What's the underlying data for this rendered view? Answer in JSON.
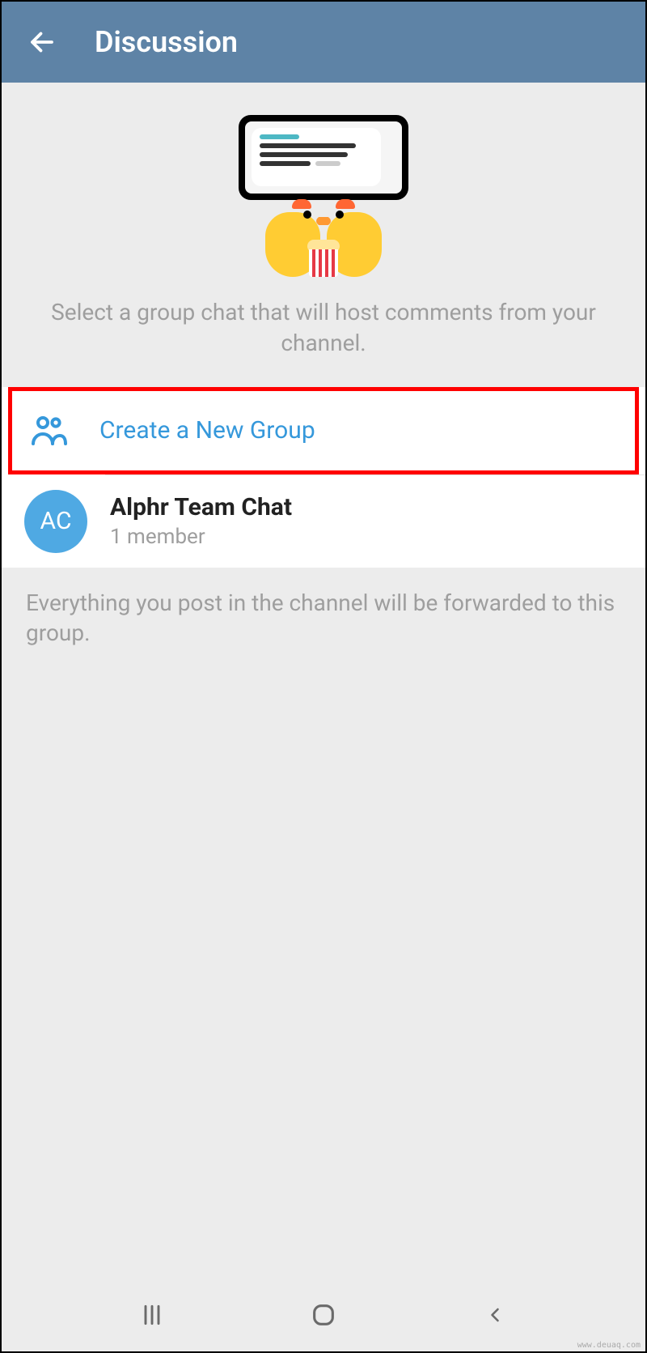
{
  "header": {
    "title": "Discussion"
  },
  "description": "Select a group chat that will host comments from your channel.",
  "actions": {
    "create_group_label": "Create a New Group"
  },
  "groups": [
    {
      "avatar_initials": "AC",
      "name": "Alphr Team Chat",
      "members": "1 member"
    }
  ],
  "footer_note": "Everything you post in the channel will be forwarded to this group.",
  "colors": {
    "header_bg": "#5e83a6",
    "accent": "#3598db",
    "avatar_bg": "#4fa9e3",
    "highlight_border": "#ff0000"
  },
  "watermark": "www.deuaq.com"
}
